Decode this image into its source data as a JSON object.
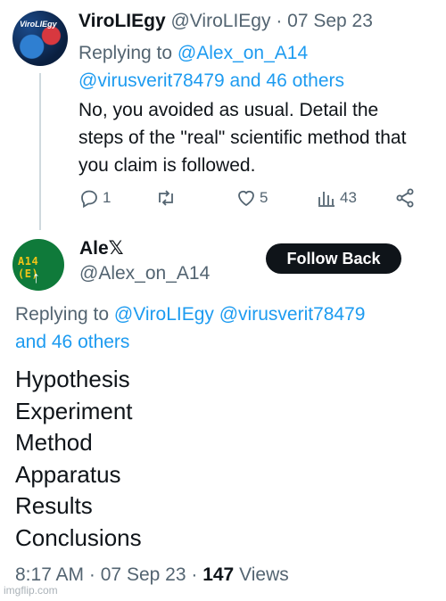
{
  "reply_tweet": {
    "avatar_text": "ViroLIEgy",
    "display_name": "ViroLIEgy",
    "handle": "@ViroLIEgy",
    "separator": "·",
    "date": "07 Sep 23",
    "replying_prefix": "Replying to",
    "replying_link1": "@Alex_on_A14",
    "replying_link2": "@virusverit78479 and 46 others",
    "text": "No, you avoided as usual. Detail the steps of the \"real\" scientific method that you claim is followed.",
    "actions": {
      "reply_icon": "comment-icon",
      "reply_count": "1",
      "retweet_icon": "retweet-icon",
      "like_icon": "heart-icon",
      "like_count": "5",
      "views_icon": "analytics-icon",
      "views_count": "43",
      "share_icon": "share-icon"
    }
  },
  "main_tweet": {
    "avatar_text": "A14 (E)",
    "avatar_arrow": "↑",
    "display_name": "Ale𝕏",
    "handle": "@Alex_on_A14",
    "follow_button": "Follow Back",
    "replying_prefix": "Replying to",
    "replying_link1": "@ViroLIEgy",
    "replying_link2": "@virusverit78479",
    "replying_link3": "and 46 others",
    "lines": [
      "Hypothesis",
      "Experiment",
      "Method",
      "Apparatus",
      "Results",
      "Conclusions"
    ],
    "time": "8:17 AM",
    "separator": "·",
    "date": "07 Sep 23",
    "views_count": "147",
    "views_label": "Views"
  },
  "watermark": "imgflip.com",
  "colors": {
    "link": "#1d9bf0",
    "secondary_text": "#536471",
    "primary_text": "#0f1419",
    "button_bg": "#0f1419"
  }
}
